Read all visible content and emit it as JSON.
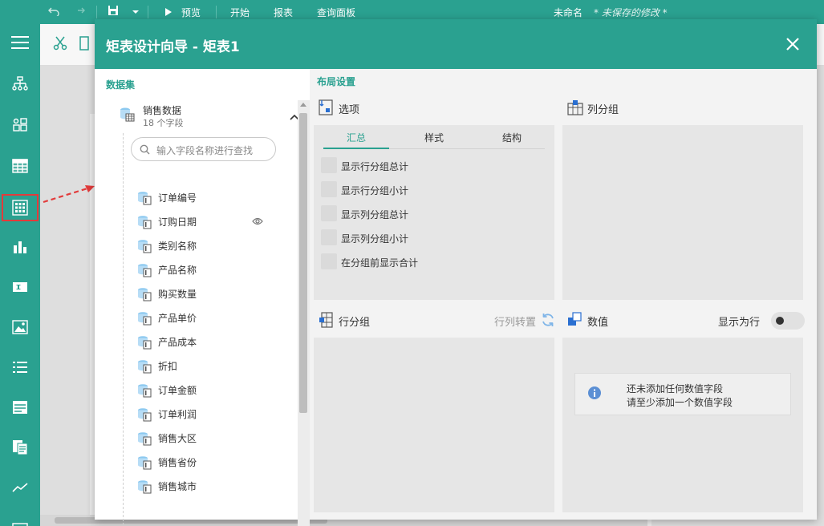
{
  "topbar": {
    "preview": "预览",
    "start": "开始",
    "report": "报表",
    "query_panel": "查询面板",
    "doc_name": "未命名",
    "doc_status": "* 未保存的修改 *"
  },
  "dialog": {
    "title": "矩表设计向导 - 矩表1"
  },
  "dataset_panel": {
    "title": "数据集",
    "dataset_name": "销售数据",
    "field_count": "18 个字段",
    "search_placeholder": "输入字段名称进行查找",
    "fields": [
      "订单编号",
      "订购日期",
      "类别名称",
      "产品名称",
      "购买数量",
      "产品单价",
      "产品成本",
      "折扣",
      "订单金额",
      "订单利润",
      "销售大区",
      "销售省份",
      "销售城市"
    ]
  },
  "layout": {
    "title": "布局设置",
    "options": {
      "label": "选项",
      "tabs": [
        "汇总",
        "样式",
        "结构"
      ],
      "active_tab": 0,
      "checkboxes": [
        "显示行分组总计",
        "显示行分组小计",
        "显示列分组总计",
        "显示列分组小计",
        "在分组前显示合计"
      ]
    },
    "column_group": {
      "label": "列分组"
    },
    "row_group": {
      "label": "行分组",
      "swap_label": "行列转置"
    },
    "values": {
      "label": "数值",
      "show_as_row": "显示为行",
      "show_as_row_on": false,
      "notice_line1": "还未添加任何数值字段",
      "notice_line2": "请至少添加一个数值字段"
    }
  },
  "colors": {
    "accent": "#2aa190",
    "highlight": "#e23b3b"
  }
}
